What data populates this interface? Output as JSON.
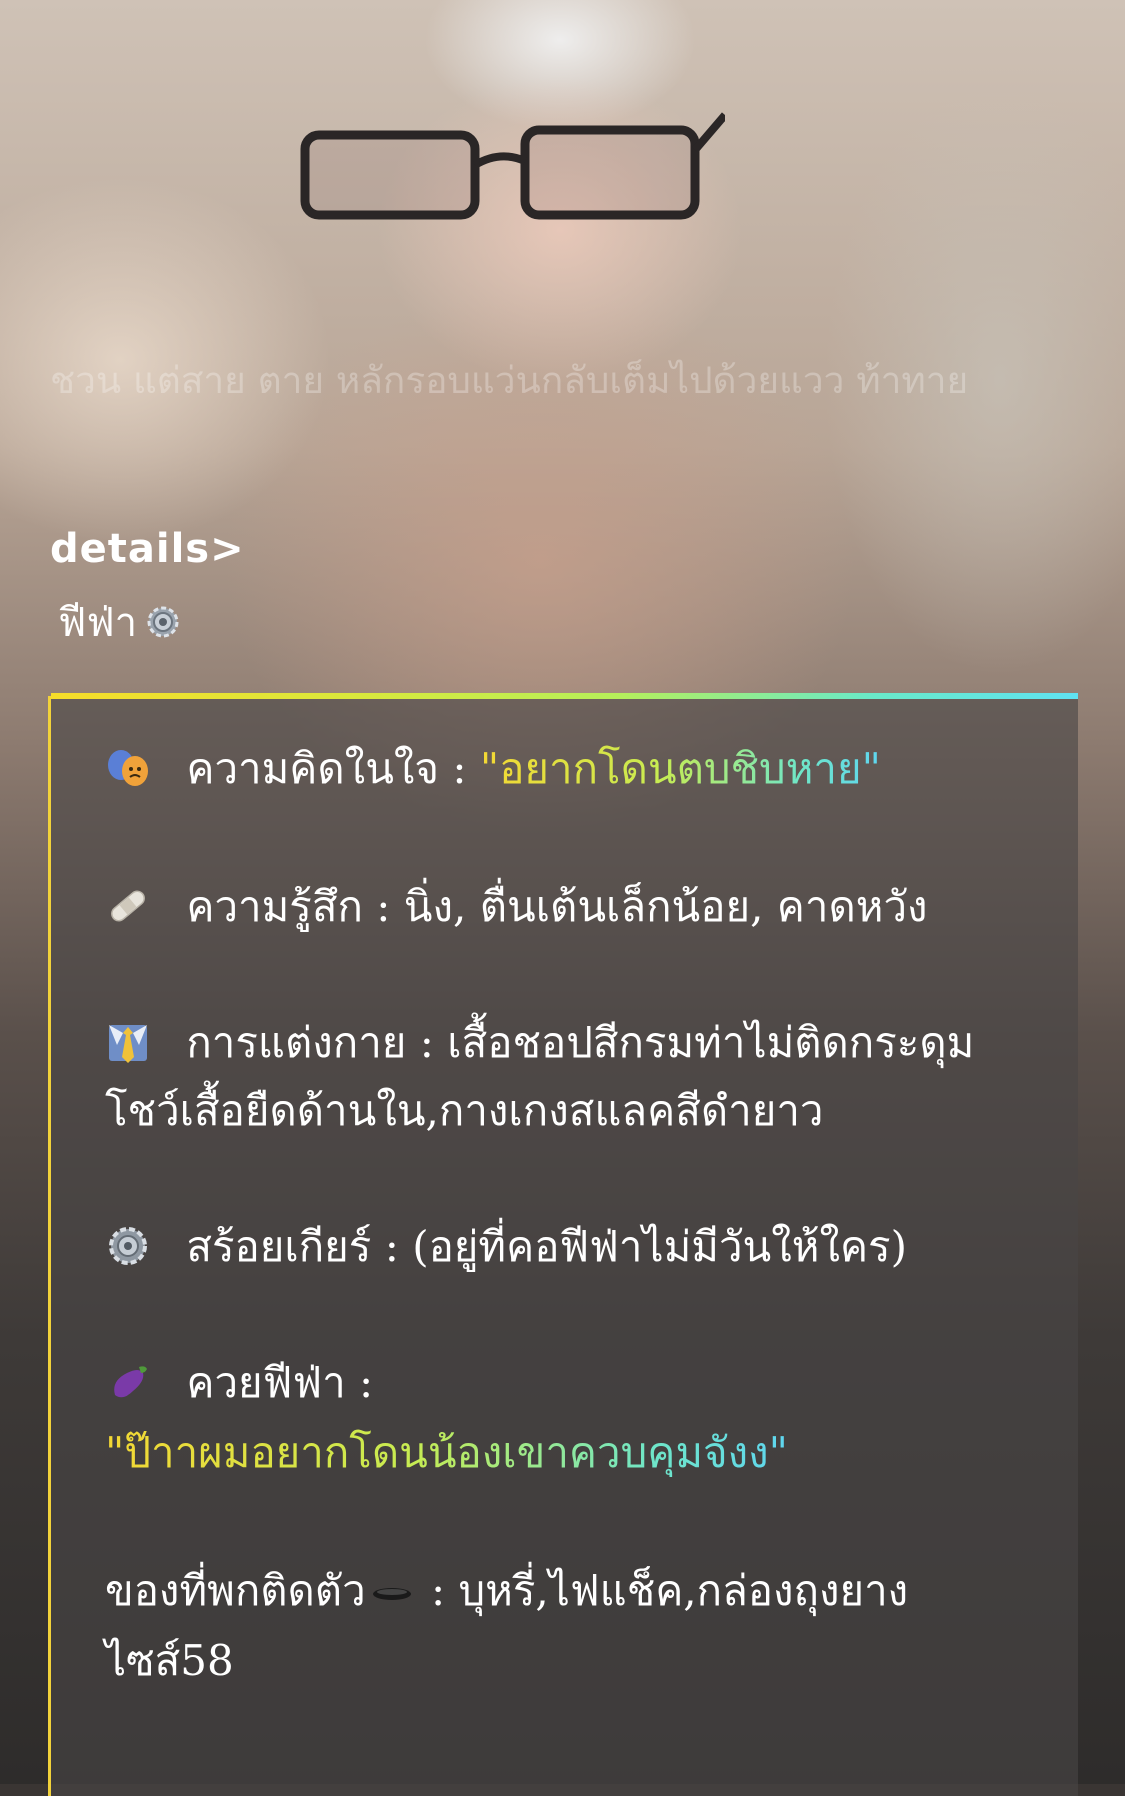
{
  "background_text": "ชวน แต่สาย    ตาย  หลักรอบแว่นกลับเต็มไปด้วยแวว ท้าทาย",
  "header": {
    "details_label": "details>",
    "name": "ฟีฟ่า"
  },
  "card": {
    "thought": {
      "icon": "theater-masks-icon",
      "label": "ความคิดในใจ : ",
      "quote": "\"อยากโดนตบชิบหาย\""
    },
    "feeling": {
      "icon": "bandage-icon",
      "text": "ความรู้สึก : นิ่ง, ตื่นเต้นเล็กน้อย, คาดหวัง"
    },
    "outfit": {
      "icon": "necktie-icon",
      "line1": "การแต่งกาย : เสื้อชอปสีกรมท่าไม่ติดกระดุม",
      "line2": "โชว์เสื้อยืดด้านใน,กางเกงสแลคสีดำยาว"
    },
    "necklace": {
      "icon": "gear-icon",
      "text": "สร้อยเกียร์ :  (อยู่ที่คอฟีฟ่าไม่มีวันให้ใคร)"
    },
    "penis": {
      "icon": "eggplant-icon",
      "label": "ควยฟีฟ่า :",
      "quote": "\"ป๊าาผมอยากโดนน้องเขาควบคุมจังง\""
    },
    "items": {
      "label": "ของที่พกติดตัว",
      "icon": "hole-icon",
      "line1": " : บุหรี่,ไฟแช็ค,กล่องถุงยาง",
      "line2": "ไซส์58"
    }
  },
  "colors": {
    "gradient_start": "#f4d834",
    "gradient_end": "#5fd6f0",
    "card_bg": "rgba(72,70,69,0.62)"
  }
}
